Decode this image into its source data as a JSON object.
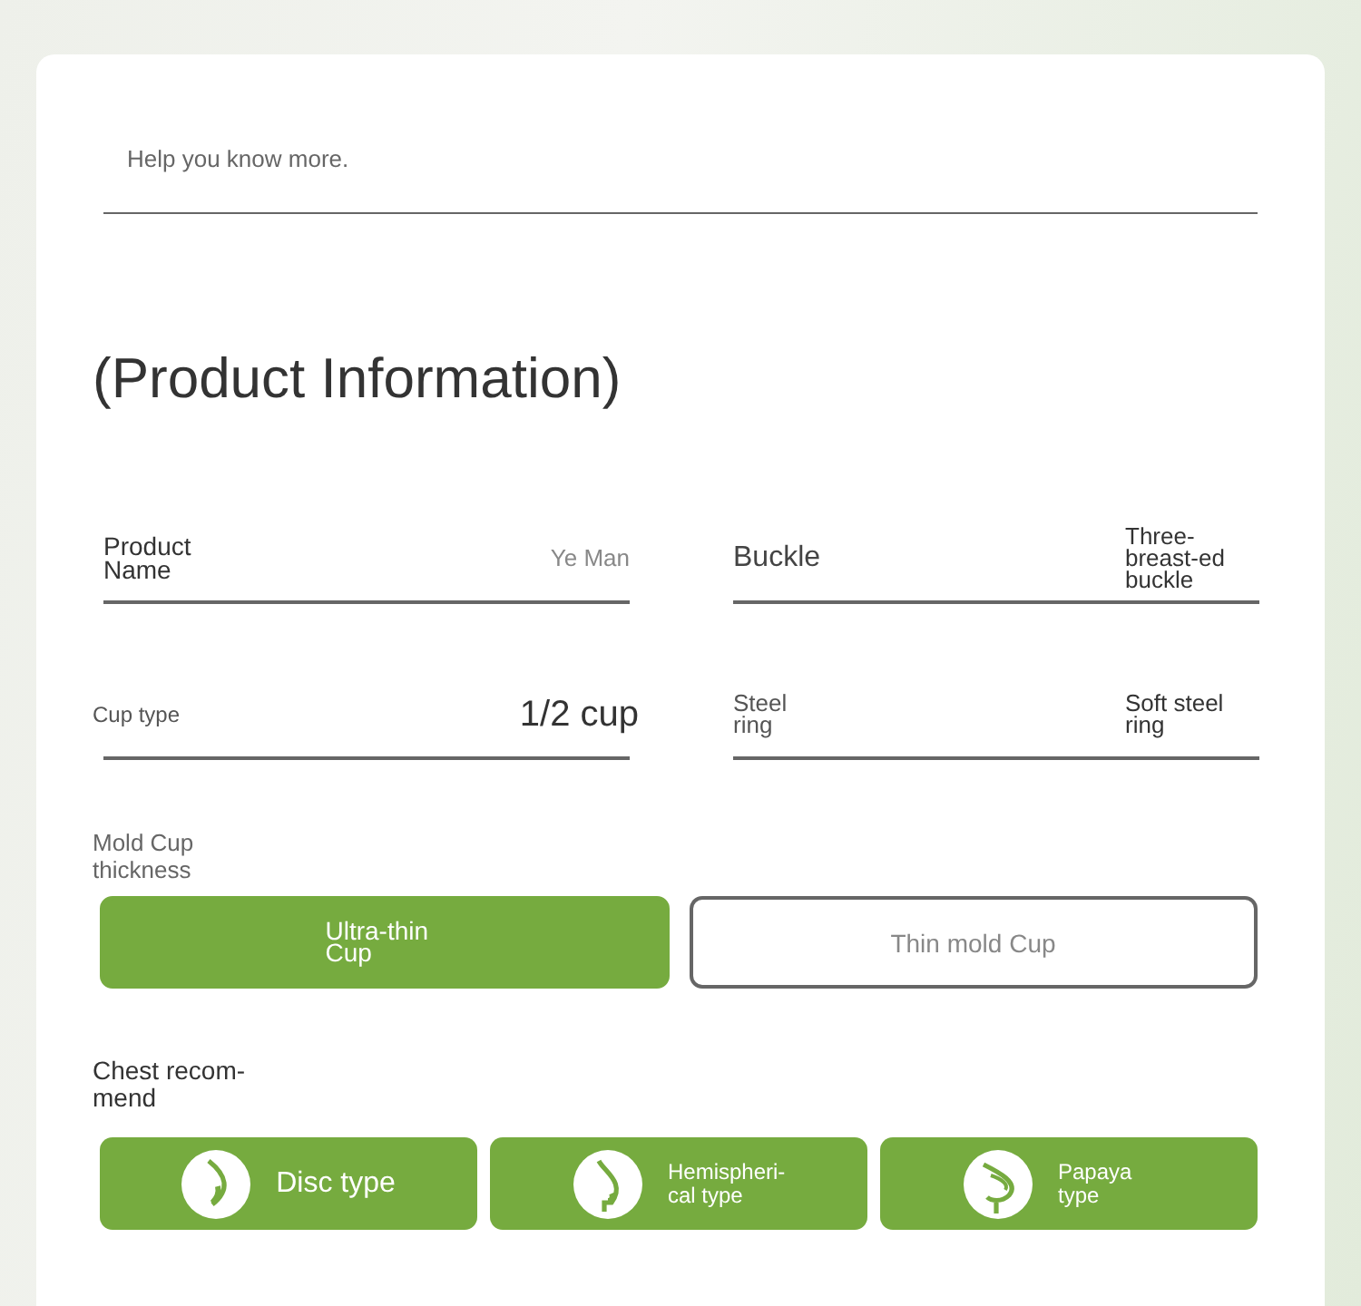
{
  "intro": {
    "placeholder": "Help you know more."
  },
  "section_title": "(Product Information)",
  "specs": [
    {
      "label": "Product Name",
      "value": "Ye Man"
    },
    {
      "label": "Buckle",
      "value": "Three-breast-ed buckle"
    },
    {
      "label": "Cup type",
      "value": "1/2 cup"
    },
    {
      "label": "Steel ring",
      "value": "Soft steel ring"
    }
  ],
  "mold_cup": {
    "label": "Mold Cup thickness",
    "options": [
      {
        "label": "Ultra-thin Cup",
        "selected": true
      },
      {
        "label": "Thin mold Cup",
        "selected": false
      }
    ]
  },
  "chest": {
    "label": "Chest recom-mend",
    "options": [
      {
        "label": "Disc type",
        "kind": "disc"
      },
      {
        "label": "Hemispheri-cal type",
        "kind": "hemispherical"
      },
      {
        "label": "Papaya type",
        "kind": "papaya"
      }
    ]
  }
}
